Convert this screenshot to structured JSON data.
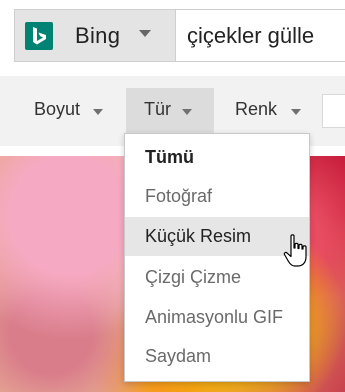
{
  "header": {
    "engine_label": "Bing",
    "search_query": "çiçekler gülle"
  },
  "filters": {
    "items": [
      {
        "label": "Boyut"
      },
      {
        "label": "Tür"
      },
      {
        "label": "Renk"
      }
    ]
  },
  "menu": {
    "items": [
      {
        "label": "Tümü"
      },
      {
        "label": "Fotoğraf"
      },
      {
        "label": "Küçük Resim"
      },
      {
        "label": "Çizgi Çizme"
      },
      {
        "label": "Animasyonlu GIF"
      },
      {
        "label": "Saydam"
      }
    ]
  },
  "icons": {
    "logo": "bing-logo-icon",
    "caret": "chevron-down-icon",
    "cursor": "hand-pointer-icon"
  },
  "colors": {
    "logo": "#008373",
    "toolbar_bg": "#f2f2f2",
    "active_filter_bg": "#dcdcdc",
    "menu_hover_bg": "#e6e6e6"
  }
}
